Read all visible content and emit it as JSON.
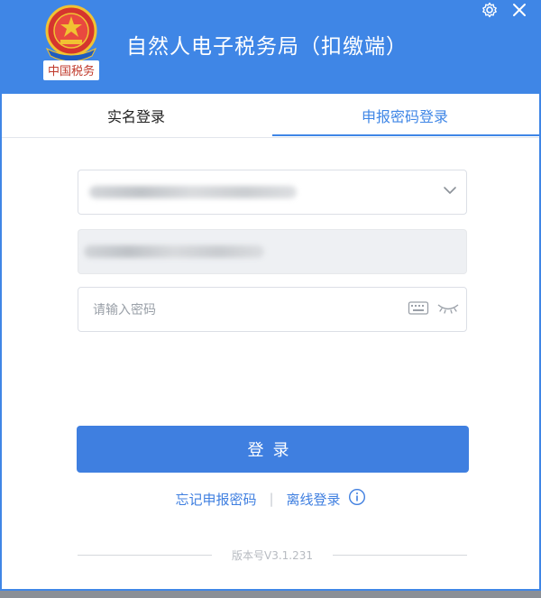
{
  "window": {
    "title": "自然人电子税务局（扣缴端）",
    "emblem_caption": "中国税务",
    "controls": {
      "settings_icon": "gear-icon",
      "close_icon": "close-icon"
    }
  },
  "tabs": [
    {
      "label": "实名登录",
      "active": false
    },
    {
      "label": "申报密码登录",
      "active": true
    }
  ],
  "form": {
    "taxpayer_select": {
      "value": "",
      "blurred": true,
      "icon": "chevron-down-icon"
    },
    "unit_field": {
      "value": "",
      "blurred": true,
      "disabled": true
    },
    "password_field": {
      "placeholder": "请输入密码",
      "keyboard_icon": "keyboard-icon",
      "eye_icon": "eye-closed-icon"
    }
  },
  "actions": {
    "login_label": "登录",
    "forgot_label": "忘记申报密码",
    "offline_label": "离线登录",
    "info_icon": "info-icon"
  },
  "footer": {
    "version": "版本号V3.1.231"
  },
  "colors": {
    "accent": "#3f86e6",
    "button": "#3f7fe0"
  }
}
